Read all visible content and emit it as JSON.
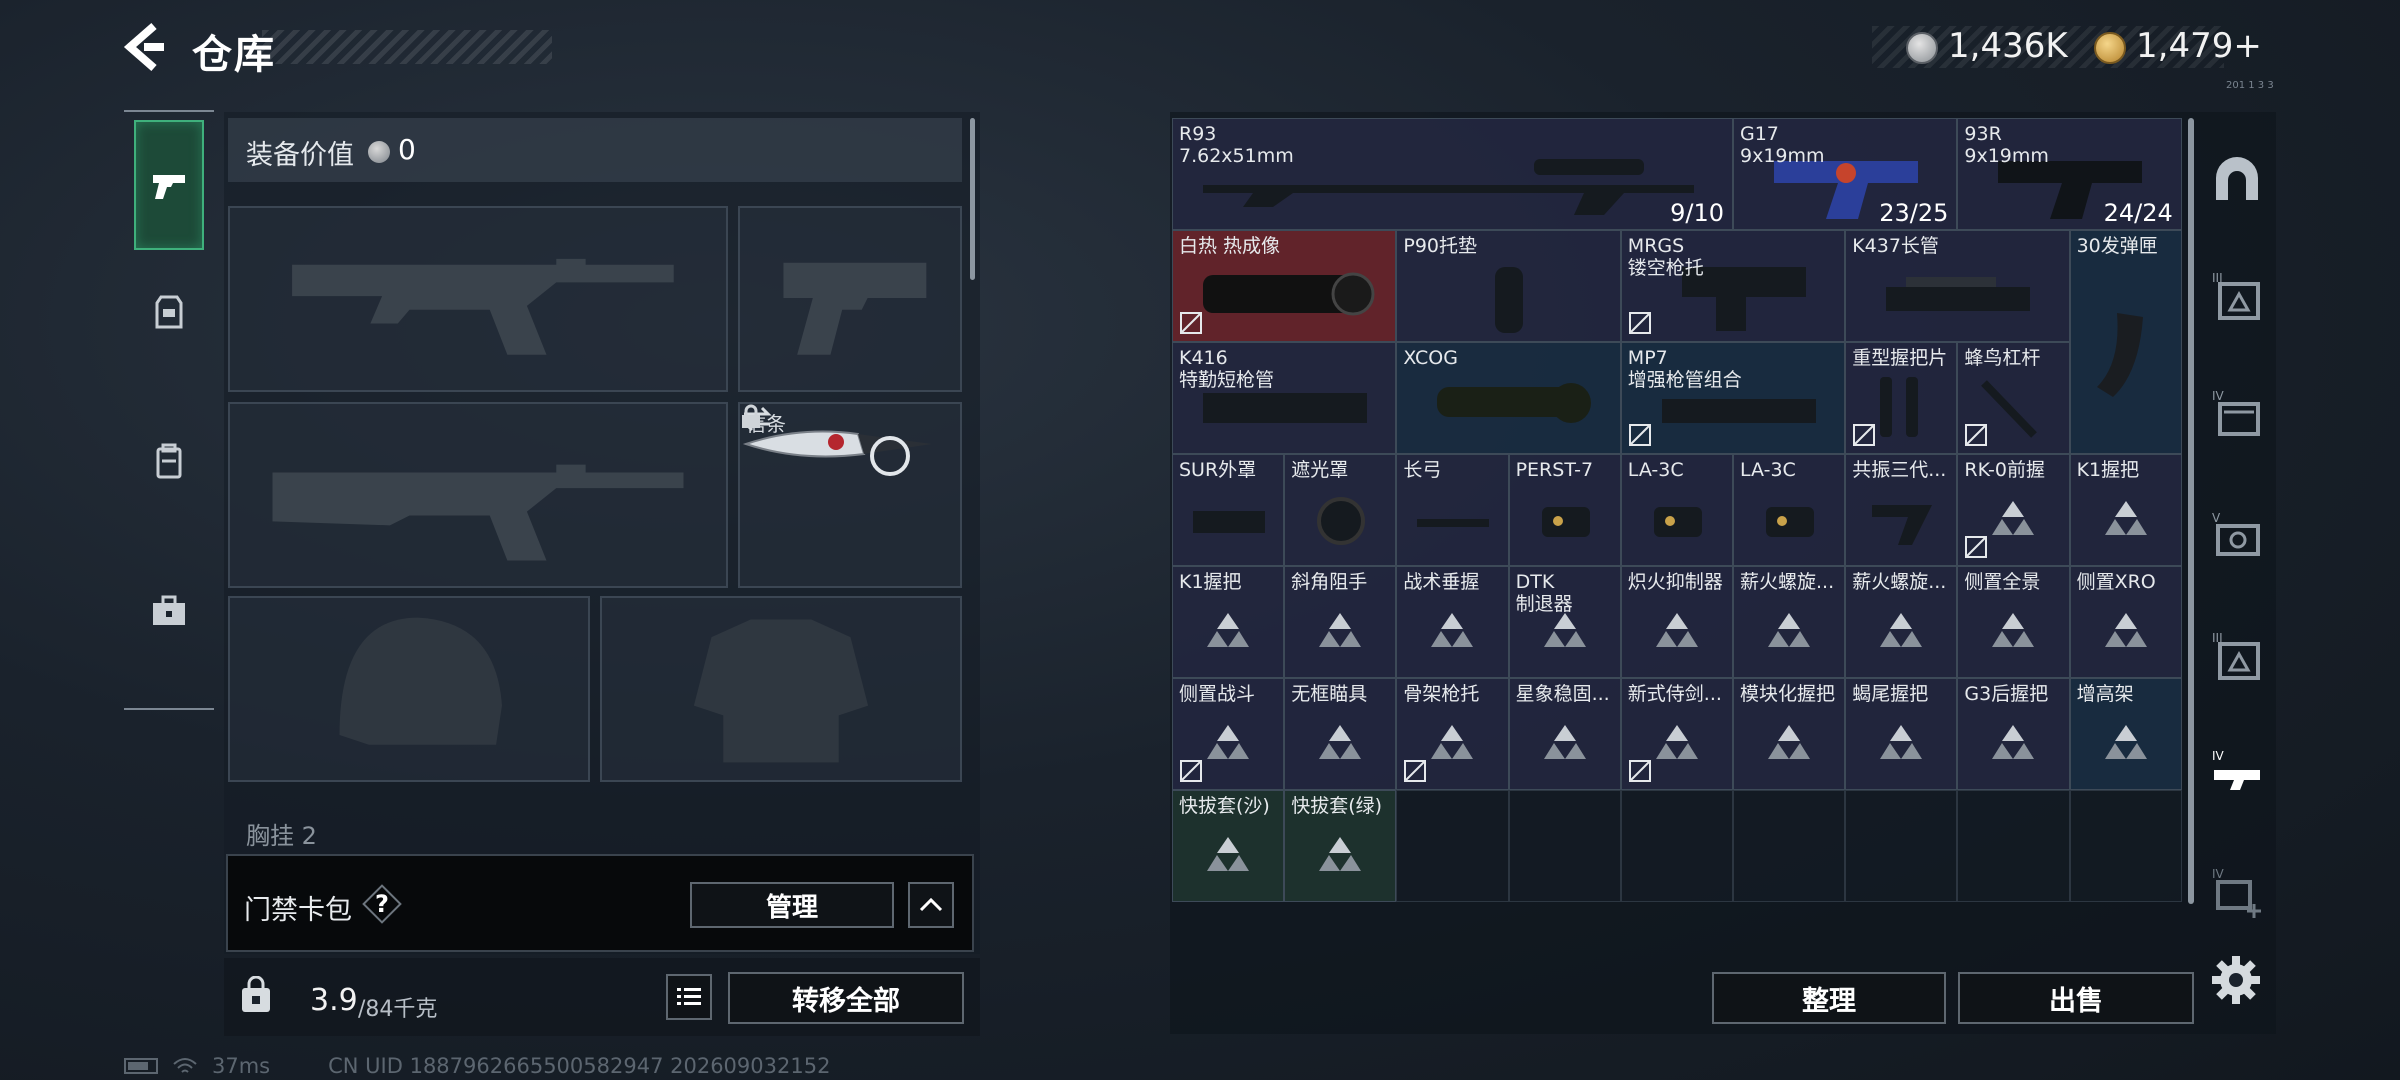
{
  "header": {
    "title": "仓库"
  },
  "currency": {
    "silver": "1,436K",
    "gold": "1,479+"
  },
  "equipment": {
    "value_label": "装备价值",
    "value": "0",
    "slot_lanyard_label": "信条",
    "chest_label": "胸挂",
    "chest_label_extra": "2"
  },
  "keycard": {
    "label": "门禁卡包",
    "help": "?",
    "manage": "管理"
  },
  "capacity": {
    "current": "3.9",
    "max": "/84千克"
  },
  "buttons": {
    "transfer_all": "转移全部",
    "sort": "整理",
    "sell": "出售"
  },
  "status": {
    "ping": "37ms",
    "uid": "CN UID 1887962665500582947 202609032152"
  },
  "hud_tiny": "201 1 3 3",
  "grid": {
    "items": [
      {
        "name": "R93",
        "sub": "7.62x51mm",
        "count": "9/10",
        "icon": "sniper-rifle"
      },
      {
        "name": "G17",
        "sub": "9x19mm",
        "count": "23/25",
        "icon": "pistol-blue"
      },
      {
        "name": "93R",
        "sub": "9x19mm",
        "count": "24/24",
        "icon": "pistol"
      },
      {
        "name": "白热 热成像",
        "icon": "thermal-scope"
      },
      {
        "name": "P90托垫",
        "icon": "buttpad"
      },
      {
        "name": "MRGS",
        "sub": "镂空枪托",
        "icon": "stock"
      },
      {
        "name": "K437长管",
        "icon": "long-barrel"
      },
      {
        "name": "30发弹匣",
        "icon": "magazine"
      },
      {
        "name": "K416",
        "sub": "特勤短枪管",
        "icon": "handguard"
      },
      {
        "name": "XCOG",
        "icon": "acog-scope"
      },
      {
        "name": "MP7",
        "sub": "增强枪管组合",
        "icon": "barrel-kit"
      },
      {
        "name": "重型握把片",
        "icon": "grip-panel"
      },
      {
        "name": "蜂鸟杠杆",
        "icon": "lever"
      },
      {
        "name": "SUR外罩",
        "icon": "shroud"
      },
      {
        "name": "遮光罩",
        "icon": "sunshade"
      },
      {
        "name": "长弓",
        "icon": "rail"
      },
      {
        "name": "PERST-7",
        "icon": "laser"
      },
      {
        "name": "LA-3C",
        "icon": "laser"
      },
      {
        "name": "LA-3C",
        "icon": "laser"
      },
      {
        "name": "共振三代...",
        "icon": "foregrip"
      },
      {
        "name": "RK-0前握",
        "icon": "unknown"
      },
      {
        "name": "K1握把",
        "icon": "unknown"
      },
      {
        "name": "K1握把",
        "icon": "unknown"
      },
      {
        "name": "斜角阻手",
        "icon": "unknown"
      },
      {
        "name": "战术垂握",
        "icon": "unknown"
      },
      {
        "name": "DTK",
        "sub": "制退器",
        "icon": "unknown"
      },
      {
        "name": "炽火抑制器",
        "icon": "unknown"
      },
      {
        "name": "薪火螺旋...",
        "icon": "unknown"
      },
      {
        "name": "薪火螺旋...",
        "icon": "unknown"
      },
      {
        "name": "侧置全景",
        "icon": "unknown"
      },
      {
        "name": "侧置XRO",
        "icon": "unknown"
      },
      {
        "name": "侧置战斗",
        "icon": "unknown"
      },
      {
        "name": "无框瞄具",
        "icon": "unknown"
      },
      {
        "name": "骨架枪托",
        "icon": "unknown"
      },
      {
        "name": "星象稳固...",
        "icon": "unknown"
      },
      {
        "name": "新式侍剑...",
        "icon": "unknown"
      },
      {
        "name": "模块化握把",
        "icon": "unknown"
      },
      {
        "name": "蝎尾握把",
        "icon": "unknown"
      },
      {
        "name": "G3后握把",
        "icon": "unknown"
      },
      {
        "name": "增高架",
        "icon": "unknown"
      },
      {
        "name": "快拔套(沙)",
        "icon": "unknown"
      },
      {
        "name": "快拔套(绿)",
        "icon": "unknown"
      }
    ]
  },
  "colors": {
    "accent_green": "#3fb07c",
    "rare_red": "#6e242c",
    "rare_blue": "#1a2e42"
  }
}
